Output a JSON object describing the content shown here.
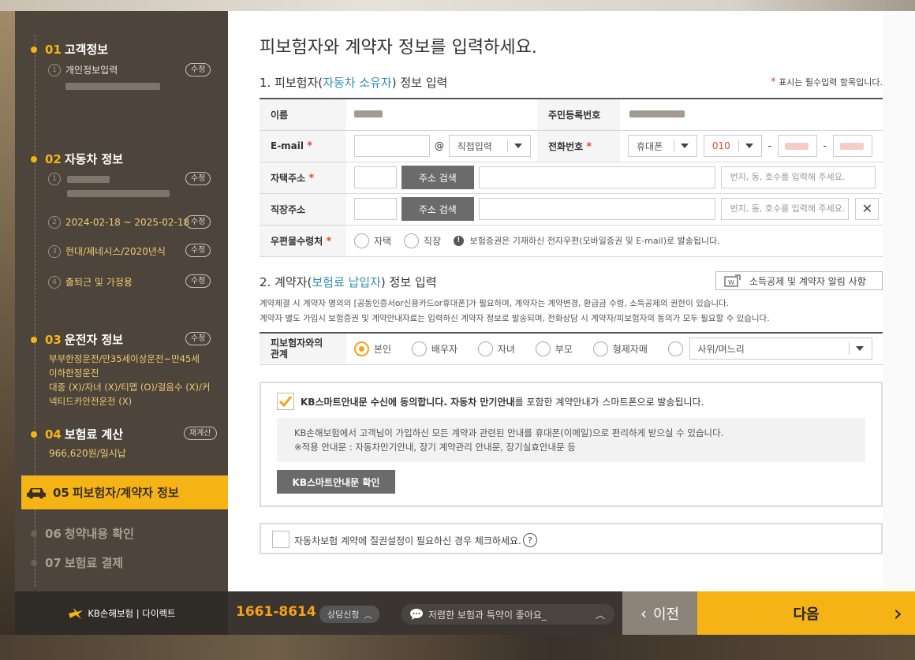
{
  "sidebar": {
    "step1": {
      "num": "01",
      "title": "고객정보",
      "sub1_num": "1",
      "sub1_label": "개인정보입력",
      "edit": "수정"
    },
    "step2": {
      "num": "02",
      "title": "자동차 정보",
      "edit": "수정",
      "sub1_num": "1",
      "sub2_num": "2",
      "sub2_label": "2024-02-18 ~ 2025-02-18",
      "sub3_num": "3",
      "sub3_label": "현대/제네시스/2020년식",
      "sub4_num": "4",
      "sub4_label": "출퇴근 및 가정용"
    },
    "step3": {
      "num": "03",
      "title": "운전자 정보",
      "edit": "수정",
      "line1": "부부한정운전/만35세이상운전~만45세",
      "line2": "이하한정운전",
      "line3": "대중 (X)/자녀 (X)/티맵 (O)/걸음수 (X)/커",
      "line4": "넥티드카안전운전 (X)"
    },
    "step4": {
      "num": "04",
      "title": "보험료 계산",
      "edit": "재계산",
      "amount": "966,620원/일시납"
    },
    "step5": {
      "num": "05",
      "title": "피보험자/계약자 정보"
    },
    "step6": {
      "num": "06",
      "title": "청약내용 확인"
    },
    "step7": {
      "num": "07",
      "title": "보험료 결제"
    }
  },
  "main": {
    "page_title": "피보험자와 계약자 정보를 입력하세요.",
    "section1": {
      "prefix": "1. 피보험자(",
      "highlight": "자동차 소유자",
      "suffix": ") 정보 입력"
    },
    "required_note": "표시는 필수입력 항목입니다.",
    "required_star": "*",
    "labels": {
      "name": "이름",
      "ssn": "주민등록번호",
      "email": "E-mail",
      "phone": "전화번호",
      "home_address": "자택주소",
      "work_address": "직장주소",
      "mail_to": "우편물수령처"
    },
    "email": {
      "at": "@",
      "domain_select": "직접입력"
    },
    "phone": {
      "type_select": "휴대폰",
      "prefix_select": "010",
      "dash": "-"
    },
    "address": {
      "search_button": "주소 검색",
      "detail_placeholder": "번지, 동, 호수를 입력해 주세요."
    },
    "mail_options": {
      "home": "자택",
      "work": "직장",
      "note": "보험증권은 기재하신 전자우편(모바일증권 및 E-mail)로 발송됩니다."
    },
    "section2": {
      "prefix": "2. 계약자(",
      "highlight": "보험료 납입자",
      "suffix": ") 정보 입력"
    },
    "notice_button": "소득공제 및 계약자 알림 사항",
    "desc1": "계약체결 시 계약자 명의의 [공동인증서or신용카드or휴대폰]가 필요하며, 계약자는 계약변경, 환급금 수령, 소득공제의 권한이 있습니다.",
    "desc2": "계약자 별도 가입시 보험증권 및 계약안내자료는 입력하신 계약자 정보로 발송되며, 전화상담 시 계약자/피보험자의 동의가 모두 필요할 수 있습니다.",
    "relation": {
      "label_line1": "피보험자와의",
      "label_line2": "관계",
      "options": [
        "본인",
        "배우자",
        "자녀",
        "부모",
        "형제자매"
      ],
      "other_select": "사위/며느리"
    },
    "smart_notice": {
      "bold_text": "KB스마트안내문 수신에 동의합니다. 자동차 만기안내",
      "rest_text": "를 포함한 계약안내가 스마트폰으로 발송됩니다.",
      "panel_line1": "KB손해보험에서 고객님이 가입하신 모든 계약과 관련된 안내를 휴대폰(이메일)으로 편리하게 받으실 수 있습니다.",
      "panel_line2": "※적용 안내문 : 자동차만기안내, 장기 계약관리 안내문, 장기실효안내문 등",
      "confirm_button": "KB스마트안내문 확인"
    },
    "lien": {
      "text": "자동차보험 계약에 질권설정이 필요하신 경우 체크하세요."
    }
  },
  "footer": {
    "logo_text": "KB손해보험 | 다이렉트",
    "phone": "1661-8614",
    "consult": "상담신청",
    "chat": "저렴한 보험과 특약이 좋아요_",
    "prev": "이전",
    "next": "다음"
  },
  "colors": {
    "accent": "#f5b316",
    "link": "#2f8fb0",
    "required": "#e8492a"
  }
}
